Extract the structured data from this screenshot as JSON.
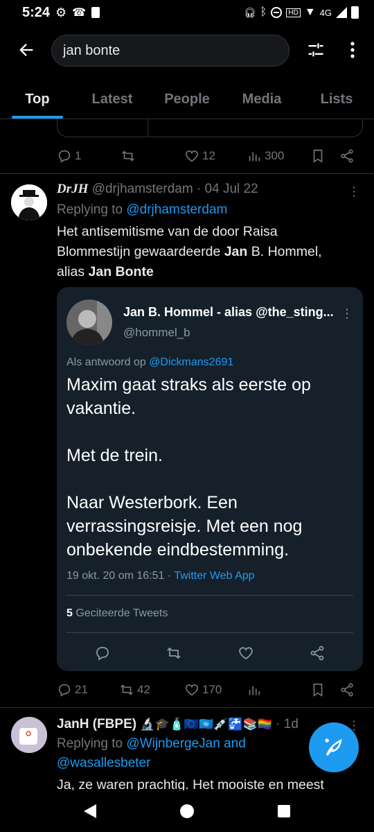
{
  "status_bar": {
    "time": "5:24",
    "network": "4G"
  },
  "search": {
    "value": "jan bonte"
  },
  "tabs": [
    {
      "label": "Top",
      "active": true
    },
    {
      "label": "Latest"
    },
    {
      "label": "People"
    },
    {
      "label": "Media"
    },
    {
      "label": "Lists"
    }
  ],
  "prev_tweet_actions": {
    "replies": "1",
    "retweets": "",
    "likes": "12",
    "views": "300"
  },
  "tweet1": {
    "display_name": "DrJH",
    "handle": "@drjhamsterdam",
    "sep_date": "· 04 Jul 22",
    "replying_prefix": "Replying to",
    "replying_to": "@drjhamsterdam",
    "body_line1": "Het antisemitisme van de door Raisa",
    "body_line2_a": "Blommestijn gewaardeerde ",
    "body_line2_b": "Jan",
    "body_line2_c": " B. Hommel,",
    "body_line3_a": "alias ",
    "body_line3_b": "Jan Bonte",
    "actions": {
      "replies": "21",
      "retweets": "42",
      "likes": "170"
    }
  },
  "quote": {
    "name": "Jan B. Hommel - alias @the_sting...",
    "handle": "@hommel_b",
    "reply_prefix": "Als antwoord op",
    "reply_to": "@Dickmans2691",
    "body": [
      "Maxim gaat straks als eerste op",
      "vakantie.",
      "",
      "Met de trein.",
      "",
      "Naar Westerbork. Een",
      "verrassingsreisje. Met een nog",
      "onbekende eindbestemming."
    ],
    "meta_date": "19 okt. 20 om 16:51 ·",
    "meta_source": "Twitter Web App",
    "quote_count": "5",
    "quote_label": "Geciteerde Tweets"
  },
  "tweet2": {
    "display_name": "JanH (FBPE)",
    "emojis": "🔬🎓🧴🇪🇺🇺🇳💉🚰📚🏳️‍🌈",
    "time": "· 1d",
    "replying_prefix": "Replying to",
    "replying_to_1": "@WijnbergeJan",
    "and": " and",
    "replying_to_2": "@wasallesbeter",
    "body_partial": "Ja, ze waren prachtig. Het mooiste en meest"
  },
  "colors": {
    "accent": "#1d9bf0",
    "background": "#000000",
    "card": "#15202b"
  },
  "icons": [
    "back-arrow-icon",
    "filter-icon",
    "more-vertical-icon",
    "reply-icon",
    "retweet-icon",
    "like-icon",
    "views-icon",
    "bookmark-icon",
    "share-icon",
    "compose-icon"
  ]
}
